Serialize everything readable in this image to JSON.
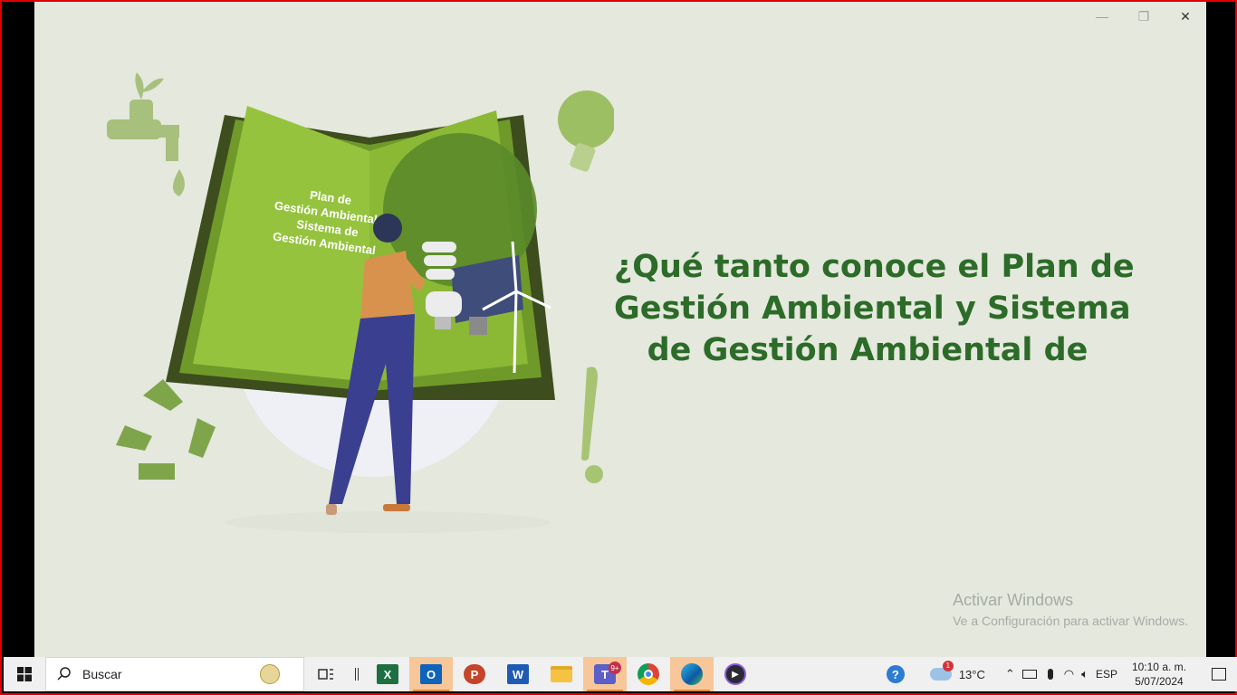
{
  "slide": {
    "book_text_lines": [
      "Plan de",
      "Gestión Ambiental y",
      "Sistema de",
      "Gestión Ambiental"
    ],
    "headline_lines": [
      "¿Qué tanto conoce el Plan de",
      "Gestión Ambiental y Sistema",
      "de Gestión Ambiental de"
    ]
  },
  "window_controls": {
    "minimize": "—",
    "restore": "❐",
    "close": "✕"
  },
  "watermark": {
    "title": "Activar Windows",
    "subtitle": "Ve a Configuración para activar Windows."
  },
  "taskbar": {
    "search_placeholder": "Buscar",
    "apps": [
      {
        "name": "task-view",
        "label": ""
      },
      {
        "name": "excel",
        "label": "X"
      },
      {
        "name": "outlook",
        "label": "O"
      },
      {
        "name": "powerpoint",
        "label": "P"
      },
      {
        "name": "word",
        "label": "W"
      },
      {
        "name": "file-explorer",
        "label": ""
      },
      {
        "name": "teams",
        "label": "T",
        "badge": "9+"
      },
      {
        "name": "chrome",
        "label": ""
      },
      {
        "name": "edge",
        "label": ""
      },
      {
        "name": "media-player",
        "label": ""
      }
    ],
    "weather": {
      "temp": "13°C",
      "badge": "1"
    },
    "language": "ESP",
    "time": "10:10 a. m.",
    "date": "5/07/2024"
  },
  "colors": {
    "accent": "#2c6b28",
    "book_green": "#8dbb3a",
    "bg": "#e4e8dd"
  }
}
